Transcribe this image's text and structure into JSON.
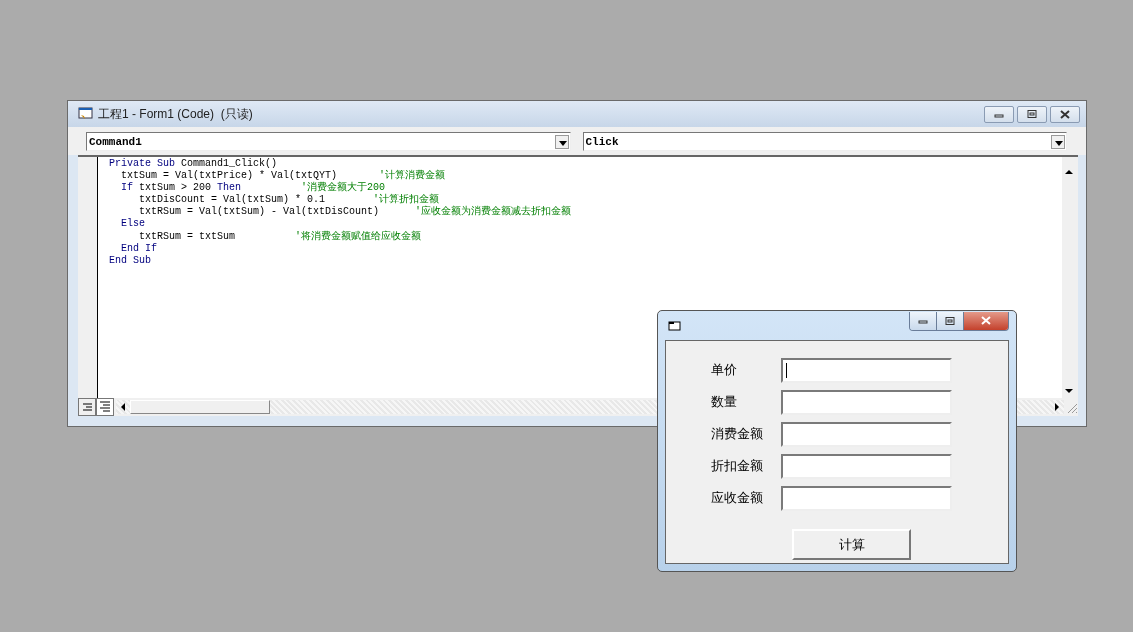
{
  "code_window": {
    "title": "工程1 - Form1 (Code)  (只读)",
    "object_combo": "Command1",
    "procedure_combo": "Click",
    "lines": [
      [
        {
          "kind": "keyword",
          "text": "Private Sub"
        },
        {
          "kind": "code",
          "text": " Command1_Click()"
        }
      ],
      [
        {
          "kind": "code",
          "text": "  txtSum = Val(txtPrice) * Val(txtQYT)       "
        },
        {
          "kind": "comment",
          "text": "'计算消费金额"
        }
      ],
      [
        {
          "kind": "keyword",
          "text": "  If"
        },
        {
          "kind": "code",
          "text": " txtSum > 200 "
        },
        {
          "kind": "keyword",
          "text": "Then"
        },
        {
          "kind": "comment",
          "text": "          '消费金额大于200"
        }
      ],
      [
        {
          "kind": "code",
          "text": "     txtDisCount = Val(txtSum) * 0.1        "
        },
        {
          "kind": "comment",
          "text": "'计算折扣金额"
        }
      ],
      [
        {
          "kind": "code",
          "text": "     txtRSum = Val(txtSum) - Val(txtDisCount)      "
        },
        {
          "kind": "comment",
          "text": "'应收金额为消费金额减去折扣金额"
        }
      ],
      [
        {
          "kind": "keyword",
          "text": "  Else"
        }
      ],
      [
        {
          "kind": "code",
          "text": "     txtRSum = txtSum          "
        },
        {
          "kind": "comment",
          "text": "'将消费金额赋值给应收金额"
        }
      ],
      [
        {
          "kind": "keyword",
          "text": "  End If"
        }
      ],
      [
        {
          "kind": "keyword",
          "text": "End Sub"
        }
      ]
    ]
  },
  "form": {
    "fields": [
      {
        "label": "单价",
        "focused": true
      },
      {
        "label": "数量",
        "focused": false
      },
      {
        "label": "消费金额",
        "focused": false
      },
      {
        "label": "折扣金额",
        "focused": false
      },
      {
        "label": "应收金额",
        "focused": false
      }
    ],
    "button": "计算"
  }
}
